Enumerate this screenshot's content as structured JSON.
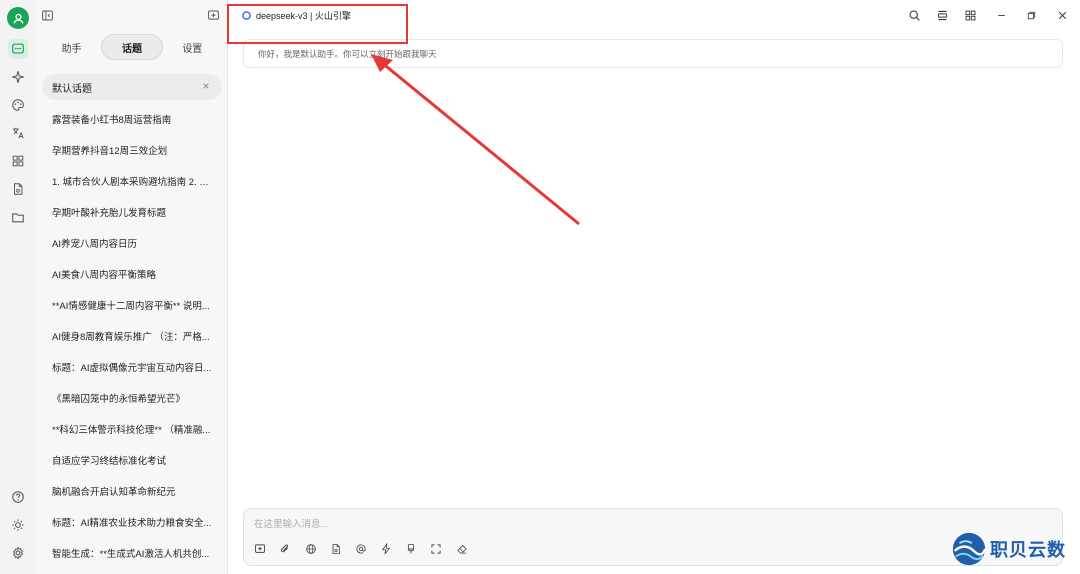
{
  "header": {
    "model_label": "deepseek-v3 | 火山引擎"
  },
  "sidebar": {
    "tabs": [
      {
        "label": "助手"
      },
      {
        "label": "话题"
      },
      {
        "label": "设置"
      }
    ],
    "active_tab": "话题",
    "current_topic": "默认话题",
    "topics": [
      {
        "label": "露营装备小红书8周运营指南"
      },
      {
        "label": "孕期营养抖音12周三效企划"
      },
      {
        "label": "1. 城市合伙人剧本采购避坑指南 2. 剧..."
      },
      {
        "label": "孕期叶酸补充胎儿发育标题"
      },
      {
        "label": "AI养宠八周内容日历"
      },
      {
        "label": "AI美食八周内容平衡策略"
      },
      {
        "label": "**AI情感健康十二周内容平衡** 说明..."
      },
      {
        "label": "AI健身8周教育娱乐推广 （注：严格..."
      },
      {
        "label": "标题：AI虚拟偶像元宇宙互动内容日..."
      },
      {
        "label": "《黑暗囚笼中的永恒希望光芒》"
      },
      {
        "label": "**科幻三体警示科技伦理** （精准融..."
      },
      {
        "label": "自适应学习终结标准化考试"
      },
      {
        "label": "脑机融合开启认知革命新纪元"
      },
      {
        "label": "标题：AI精准农业技术助力粮食安全..."
      },
      {
        "label": "智能生成：**生成式AI激活人机共创..."
      }
    ]
  },
  "chat": {
    "greeting": "你好，我是默认助手。你可以立刻开始跟我聊天"
  },
  "composer": {
    "placeholder": "在这里输入消息..."
  },
  "watermark": {
    "text": "职贝云数"
  },
  "colors": {
    "accent": "#1aa35b",
    "annotation": "#e53935",
    "watermark": "#1f5fa8"
  }
}
